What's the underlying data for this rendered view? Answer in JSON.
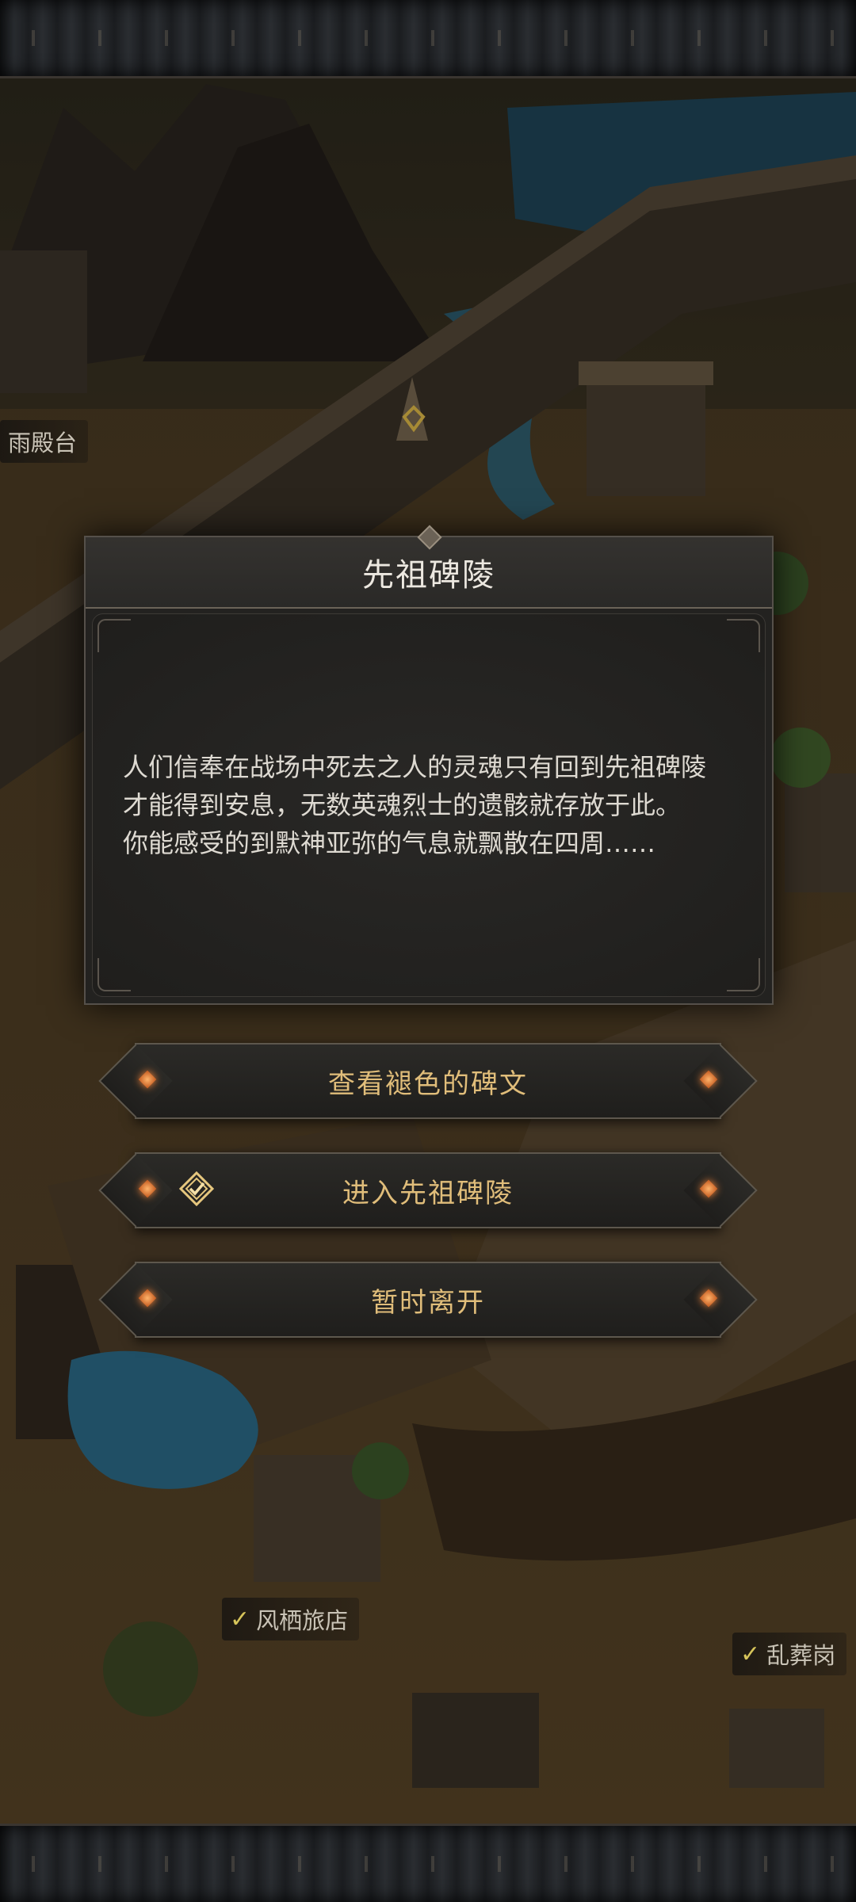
{
  "map": {
    "labels": [
      {
        "id": "yu-dian-tai",
        "text": "雨殿台",
        "checked": false
      },
      {
        "id": "feng-qi-lv-dian",
        "text": "风栖旅店",
        "checked": true
      },
      {
        "id": "luan-zang-gang",
        "text": "乱葬岗",
        "checked": true
      }
    ]
  },
  "dialog": {
    "title": "先祖碑陵",
    "body": "人们信奉在战场中死去之人的灵魂只有回到先祖碑陵\n才能得到安息，无数英魂烈士的遗骸就存放于此。\n你能感受的到默神亚弥的气息就飘散在四周……"
  },
  "options": [
    {
      "label": "查看褪色的碑文",
      "icon": null
    },
    {
      "label": "进入先祖碑陵",
      "icon": "quest-check-icon"
    },
    {
      "label": "暂时离开",
      "icon": null
    }
  ],
  "colors": {
    "option_text": "#e0bd7a",
    "check": "#d6c45a",
    "gem": "#ff8a3a"
  }
}
